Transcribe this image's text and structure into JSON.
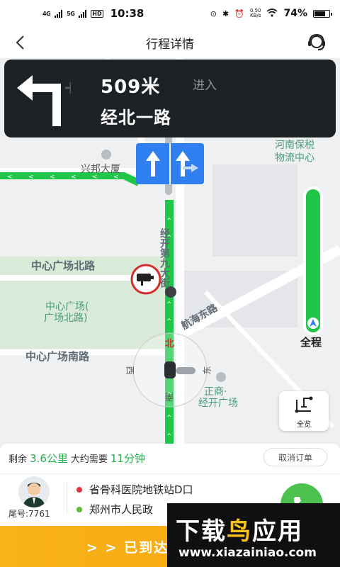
{
  "status_bar": {
    "network_1": "4G",
    "network_2": "5G",
    "hd": "HD",
    "time": "10:38",
    "speed_value": "0.50",
    "speed_unit": "KB/s",
    "battery": "74%",
    "battery_level": 0.74
  },
  "header": {
    "title": "行程详情",
    "back_icon": "chevron-left-icon",
    "support_icon": "customer-service-icon"
  },
  "navigation": {
    "distance": "509米",
    "action": "进入",
    "road": "经北一路",
    "turn_icon": "turn-left-arrow-icon"
  },
  "map": {
    "pois": [
      "兴邦大厦",
      "河南保税",
      "物流中心",
      "中心广场北路",
      "中心广场(",
      "广场北路)",
      "中心广场南路",
      "正商·",
      "经开广场"
    ],
    "roads": [
      "经开第九大街",
      "航海东路"
    ],
    "compass_labels": {
      "north": "北",
      "south": "南",
      "east": "东",
      "west": "西"
    },
    "route_color": "#1fc64a",
    "lane_color": "#2f7ff0"
  },
  "progress": {
    "label": "全程",
    "remaining_fraction": 0.0
  },
  "overview": {
    "label": "全览"
  },
  "trip": {
    "remaining_label": "剩余",
    "remaining_value": "3.6公里",
    "eta_label": "大约需要",
    "eta_value": "11分钟",
    "cancel_label": "取消订单"
  },
  "passenger": {
    "tail_label": "尾号:7761",
    "origin": "省骨科医院地铁站D口",
    "destination": "郑州市人民政",
    "origin_color": "#e5333b",
    "destination_color": "#5dbb3a"
  },
  "arrive": {
    "label": "> > 已到达"
  },
  "watermark": {
    "title_a": "下载",
    "title_b": "鸟",
    "title_c": "应用",
    "url": "www.xiazainiao.com"
  }
}
